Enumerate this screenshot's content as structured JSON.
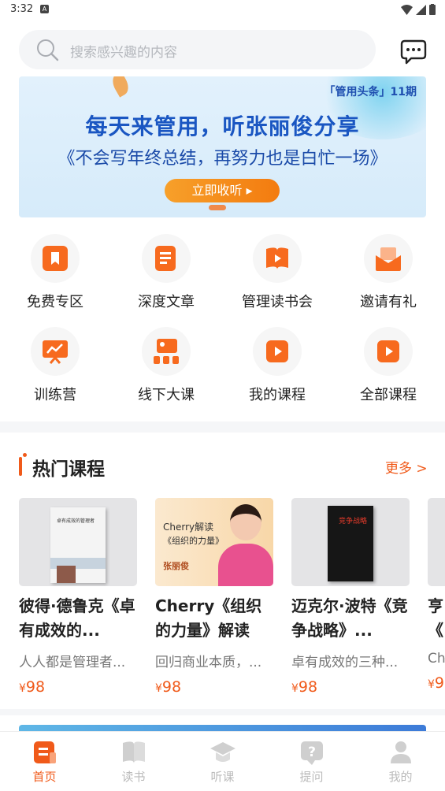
{
  "status": {
    "time": "3:32"
  },
  "search": {
    "placeholder": "搜索感兴趣的内容"
  },
  "banner": {
    "tag": "「管用头条」11期",
    "title": "每天来管用，听张丽俊分享",
    "subtitle": "《不会写年终总结，再努力也是白忙一场》",
    "button_label": "立即收听 ▸"
  },
  "grid": [
    {
      "label": "免费专区",
      "icon": "bookmark-icon"
    },
    {
      "label": "深度文章",
      "icon": "article-icon"
    },
    {
      "label": "管理读书会",
      "icon": "book-play-icon"
    },
    {
      "label": "邀请有礼",
      "icon": "envelope-icon"
    },
    {
      "label": "训练营",
      "icon": "presentation-icon"
    },
    {
      "label": "线下大课",
      "icon": "classroom-icon"
    },
    {
      "label": "我的课程",
      "icon": "play-icon"
    },
    {
      "label": "全部课程",
      "icon": "play-icon"
    }
  ],
  "hot": {
    "title": "热门课程",
    "more": "更多 >",
    "courses": [
      {
        "title": "彼得·德鲁克《卓有成效的...",
        "desc": "人人都是管理者...",
        "price": "98",
        "cover_text": "卓有成效的管理者"
      },
      {
        "title": "Cherry《组织的力量》解读",
        "desc": "回归商业本质，...",
        "price": "98",
        "cover_line1": "Cherry解读",
        "cover_line2": "《组织的力量》",
        "cover_line3": "张丽俊"
      },
      {
        "title": "迈克尔·波特《竞争战略》...",
        "desc": "卓有成效的三种...",
        "price": "98",
        "cover_text": "竞争战略"
      },
      {
        "title": "亨《",
        "desc": "Ch",
        "price": "9"
      }
    ],
    "currency": "¥"
  },
  "tabs": [
    {
      "label": "首页",
      "icon": "home-icon",
      "active": true
    },
    {
      "label": "读书",
      "icon": "book-icon",
      "active": false
    },
    {
      "label": "听课",
      "icon": "graduation-cap-icon",
      "active": false
    },
    {
      "label": "提问",
      "icon": "question-icon",
      "active": false
    },
    {
      "label": "我的",
      "icon": "user-icon",
      "active": false
    }
  ],
  "colors": {
    "accent": "#f05a1a",
    "banner_blue": "#1a56c2",
    "tab_inactive": "#bbbbbb"
  }
}
